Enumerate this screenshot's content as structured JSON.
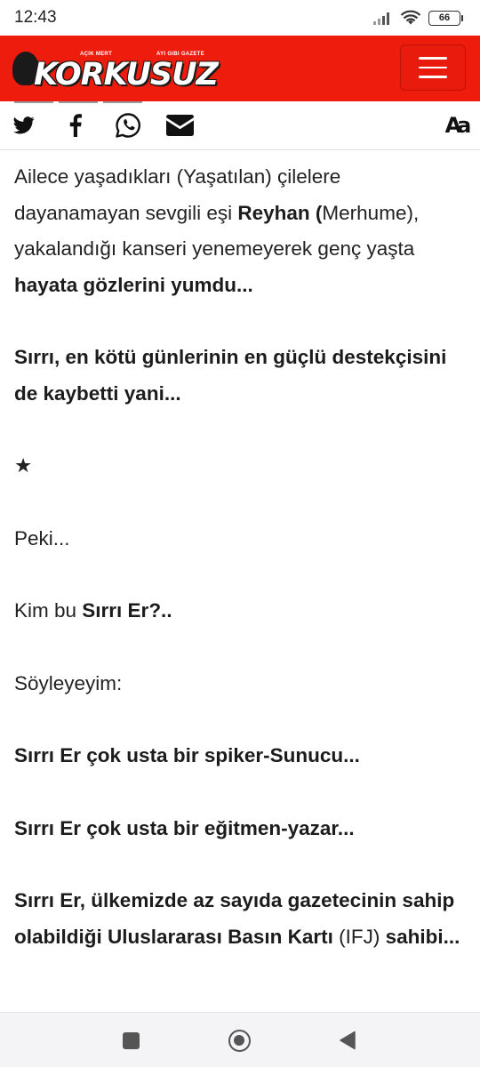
{
  "status_bar": {
    "time": "12:43",
    "battery": "66",
    "icons": [
      "signal-icon",
      "wifi-icon",
      "battery-icon"
    ]
  },
  "header": {
    "brand": "KORKUSUZ",
    "tagline_left": "AÇIK MERT",
    "tagline_right": "AYI GIBI GAZETE",
    "menu_icon": "hamburger-menu-icon",
    "background_color": "#ee1c0c"
  },
  "share_bar": {
    "icons": [
      "twitter-icon",
      "facebook-icon",
      "whatsapp-icon",
      "mail-icon"
    ],
    "font_size_label": "Aa"
  },
  "article": {
    "p1": {
      "t1": "Ailece yaşadıkları (Yaşatılan) çilelere dayanamayan sevgili eşi ",
      "b1": "Reyhan (",
      "t2": "Merhume), yakalandığı kanseri yenemeyerek genç yaşta ",
      "b2": "hayata gözlerini yumdu..."
    },
    "p2": "Sırrı, en kötü günlerinin en güçlü destekçisini de kaybetti yani...",
    "p3": "★",
    "p4": "Peki...",
    "p5": {
      "t1": "Kim bu ",
      "b1": "Sırrı Er?.."
    },
    "p6": "Söyleyeyim:",
    "p7": "Sırrı Er çok usta bir spiker-Sunucu...",
    "p8": "Sırrı Er çok usta bir eğitmen-yazar...",
    "p9": {
      "b1": "Sırrı Er, ülkemizde az sayıda gazetecinin sahip olabildiği Uluslararası Basın Kartı",
      "t1": " (IFJ) ",
      "b2": "sahibi..."
    }
  },
  "nav_bar": {
    "icons": [
      "recents-square-icon",
      "home-circle-icon",
      "back-triangle-icon"
    ]
  }
}
